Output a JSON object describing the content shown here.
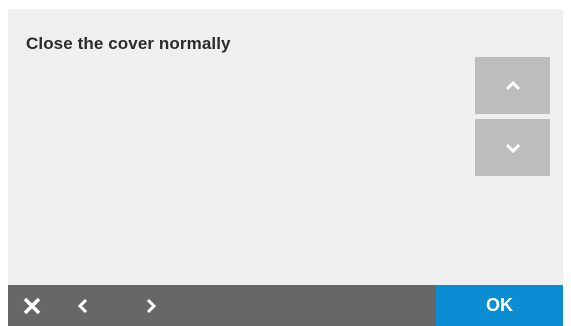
{
  "dialog": {
    "message": "Close the cover normally"
  },
  "scroll": {
    "up_icon": "chevron-up-icon",
    "down_icon": "chevron-down-icon"
  },
  "bottom_bar": {
    "close_icon": "close-icon",
    "back_icon": "chevron-left-icon",
    "next_icon": "chevron-right-icon",
    "ok_label": "OK"
  },
  "colors": {
    "screen_bg": "#efefef",
    "scroll_button": "#bdbdbd",
    "bottom_bar": "#676767",
    "ok_accent": "#0a8dd3"
  }
}
